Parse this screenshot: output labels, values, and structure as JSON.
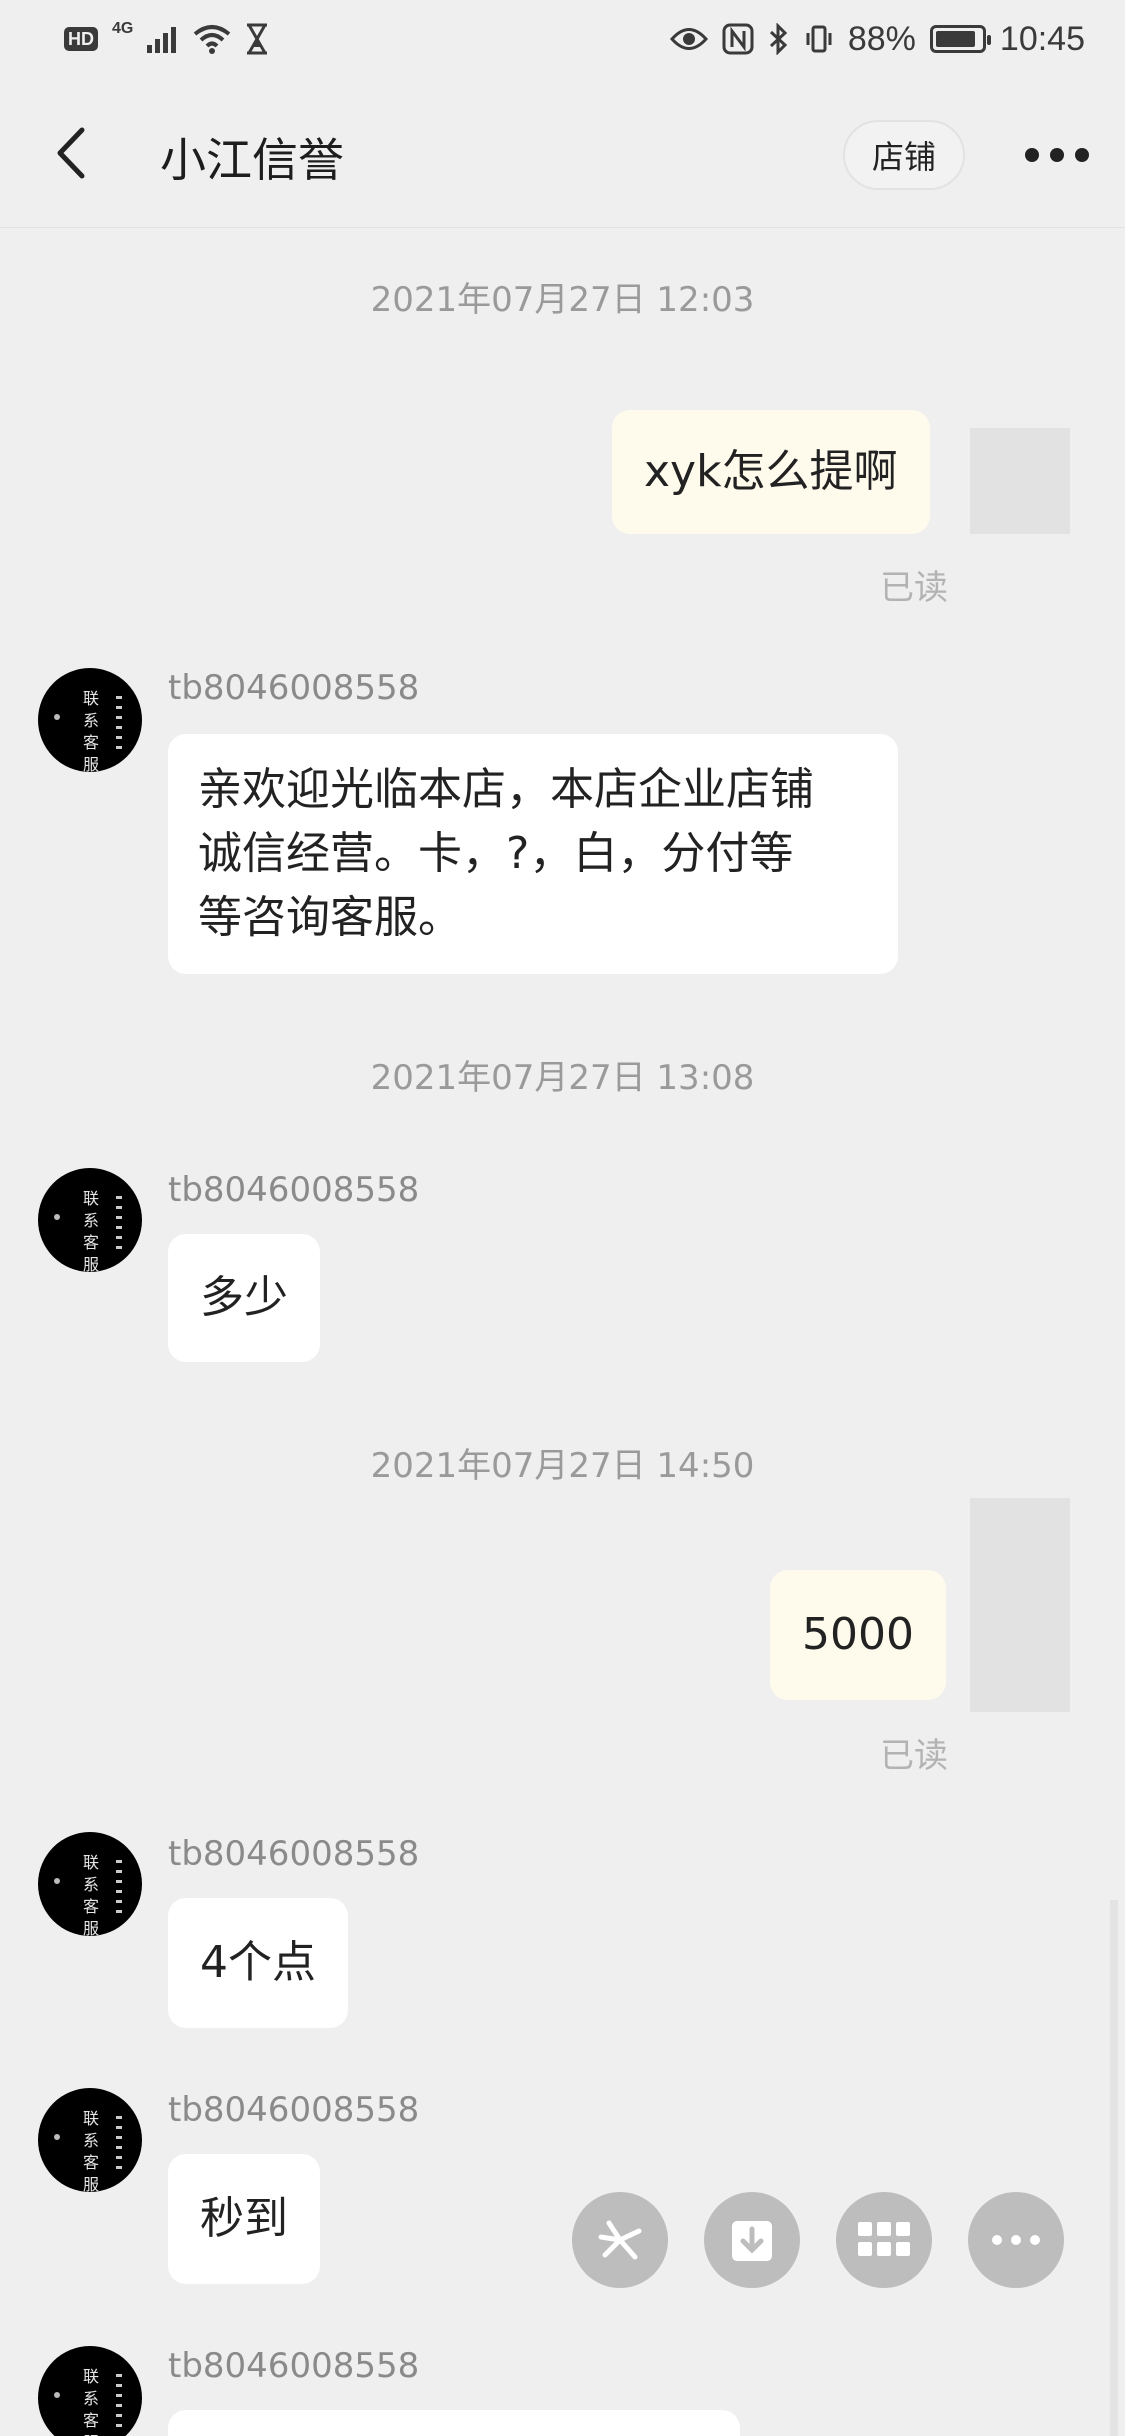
{
  "status_bar": {
    "hd_badge": "HD",
    "network": "4G",
    "battery_level": "88%",
    "battery_fraction": 0.88,
    "time": "10:45"
  },
  "header": {
    "title": "小江信誉",
    "shop_label": "店铺"
  },
  "chat": {
    "messages": [
      {
        "type": "timestamp",
        "text": "2021年07月27日 12:03"
      },
      {
        "type": "self",
        "text": "xyk怎么提啊",
        "status": "已读"
      },
      {
        "type": "other",
        "sender": "tb8046008558",
        "lines": [
          "亲欢迎光临本店，本店企业店铺",
          "诚信经营。卡，?，白，分付等",
          "等咨询客服。"
        ]
      },
      {
        "type": "timestamp",
        "text": "2021年07月27日 13:08"
      },
      {
        "type": "other",
        "sender": "tb8046008558",
        "text": "多少"
      },
      {
        "type": "timestamp",
        "text": "2021年07月27日 14:50"
      },
      {
        "type": "self",
        "text": "5000",
        "status": "已读"
      },
      {
        "type": "other",
        "sender": "tb8046008558",
        "text": "4个点"
      },
      {
        "type": "other",
        "sender": "tb8046008558",
        "text": "秒到"
      },
      {
        "type": "other",
        "sender": "tb8046008558",
        "text": ""
      }
    ],
    "avatar_text": "联系客服"
  },
  "icons": {
    "back": "chevron-left-icon",
    "more": "more-dots-icon",
    "fab_1": "pinwheel-icon",
    "fab_2": "download-icon",
    "fab_3": "grid-icon",
    "fab_4": "ellipsis-icon"
  },
  "colors": {
    "background": "#efefef",
    "self_bubble": "#fefbec",
    "other_bubble": "#ffffff",
    "fab": "#bdbdbd"
  }
}
